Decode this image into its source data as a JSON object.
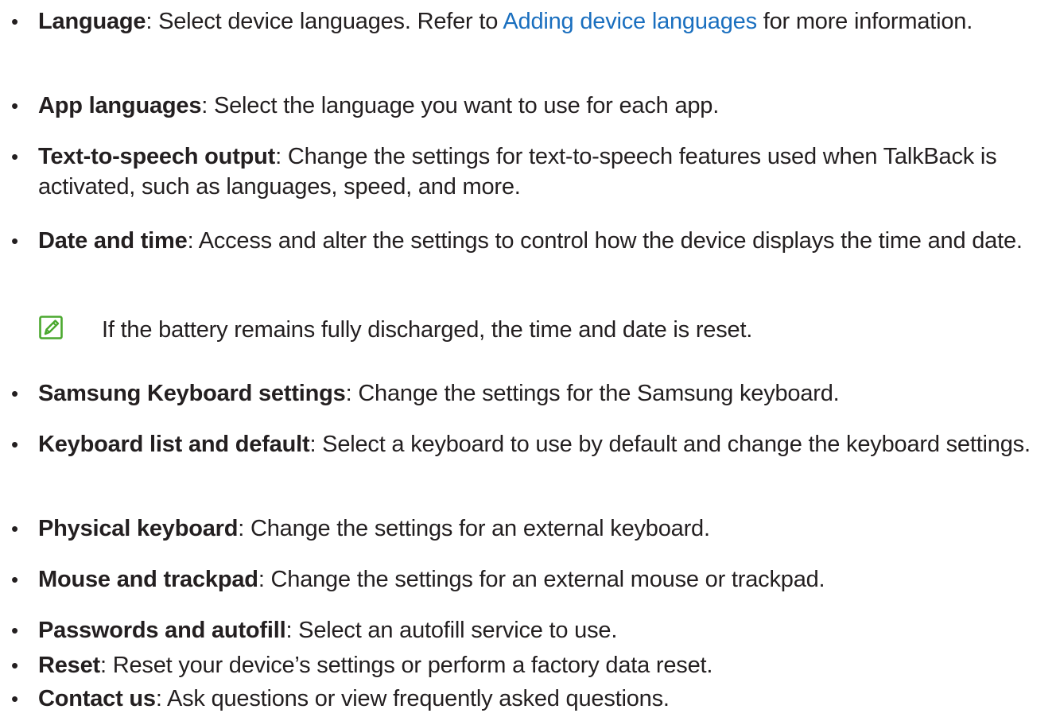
{
  "bullet_glyph": "•",
  "items": [
    {
      "term": "Language",
      "sep": ": ",
      "pre": "Select device languages. Refer to ",
      "link": "Adding device languages",
      "post": " for more information."
    },
    {
      "term": "App languages",
      "sep": ": ",
      "desc": "Select the language you want to use for each app."
    },
    {
      "term": "Text-to-speech output",
      "sep": ": ",
      "desc": "Change the settings for text-to-speech features used when TalkBack is activated, such as languages, speed, and more."
    },
    {
      "term": "Date and time",
      "sep": ": ",
      "desc": "Access and alter the settings to control how the device displays the time and date."
    },
    {
      "term": "Samsung Keyboard settings",
      "sep": ": ",
      "desc": "Change the settings for the Samsung keyboard."
    },
    {
      "term": "Keyboard list and default",
      "sep": ": ",
      "desc": "Select a keyboard to use by default and change the keyboard settings."
    },
    {
      "term": "Physical keyboard",
      "sep": ": ",
      "desc": "Change the settings for an external keyboard."
    },
    {
      "term": "Mouse and trackpad",
      "sep": ": ",
      "desc": "Change the settings for an external mouse or trackpad."
    },
    {
      "term": "Passwords and autofill",
      "sep": ": ",
      "desc": "Select an autofill service to use."
    },
    {
      "term": "Reset",
      "sep": ": ",
      "desc": "Reset your device’s settings or perform a factory data reset."
    },
    {
      "term": "Contact us",
      "sep": ": ",
      "desc": "Ask questions or view frequently asked questions."
    }
  ],
  "note": {
    "icon": "note-pencil-icon",
    "text": "If the battery remains fully discharged, the time and date is reset."
  },
  "colors": {
    "text": "#231f20",
    "link": "#1a6fbf",
    "note_icon": "#4aa82e"
  }
}
